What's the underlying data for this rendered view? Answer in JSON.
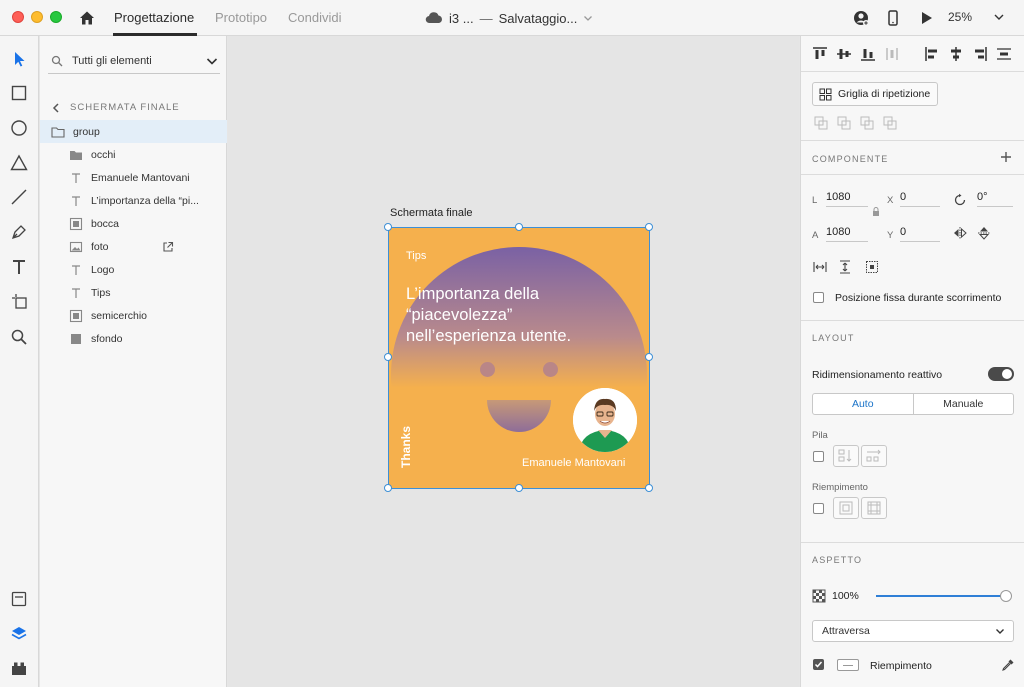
{
  "window": {
    "tabs": [
      "Progettazione",
      "Prototipo",
      "Condividi"
    ],
    "active_tab": "Progettazione",
    "doc_name": "i3 ...",
    "separator": "—",
    "save_status": "Salvataggio...",
    "zoom": "25%"
  },
  "layers": {
    "search_placeholder": "Tutti gli elementi",
    "breadcrumb": "SCHERMATA FINALE",
    "items": [
      {
        "label": "group",
        "icon": "folder-icon"
      },
      {
        "label": "occhi",
        "icon": "folder-icon"
      },
      {
        "label": "Emanuele Mantovani",
        "icon": "text-icon"
      },
      {
        "label": "L’importanza della “pi...",
        "icon": "text-icon"
      },
      {
        "label": "bocca",
        "icon": "path-icon"
      },
      {
        "label": "foto",
        "icon": "image-icon"
      },
      {
        "label": "Logo",
        "icon": "text-icon"
      },
      {
        "label": "Tips",
        "icon": "text-icon"
      },
      {
        "label": "semicerchio",
        "icon": "path-icon"
      },
      {
        "label": "sfondo",
        "icon": "rectangle-icon"
      }
    ]
  },
  "artboard": {
    "label": "Schermata finale",
    "tips": "Tips",
    "title": "L’importanza della “piacevolezza” nell’esperienza utente.",
    "name": "Emanuele Mantovani",
    "thanks": "Thanks",
    "colors": {
      "background": "#f5b04d",
      "purple": "#7a61a4"
    }
  },
  "properties": {
    "repeat_grid": "Griglia di ripetizione",
    "component_title": "COMPONENTE",
    "w_label": "L",
    "w_value": "1080",
    "h_label": "A",
    "h_value": "1080",
    "x_label": "X",
    "x_value": "0",
    "y_label": "Y",
    "y_value": "0",
    "rotation": "0°",
    "fixed_position": "Posizione fissa durante scorrimento",
    "layout_title": "LAYOUT",
    "responsive_resize": "Ridimensionamento reattivo",
    "seg_auto": "Auto",
    "seg_manual": "Manuale",
    "stack_label": "Pila",
    "padding_label": "Riempimento",
    "appearance_title": "ASPETTO",
    "opacity": "100%",
    "opacity_fraction": 1.0,
    "blend_mode": "Attraversa",
    "fill_label": "Riempimento",
    "accent_color": "#2f7fd6"
  }
}
